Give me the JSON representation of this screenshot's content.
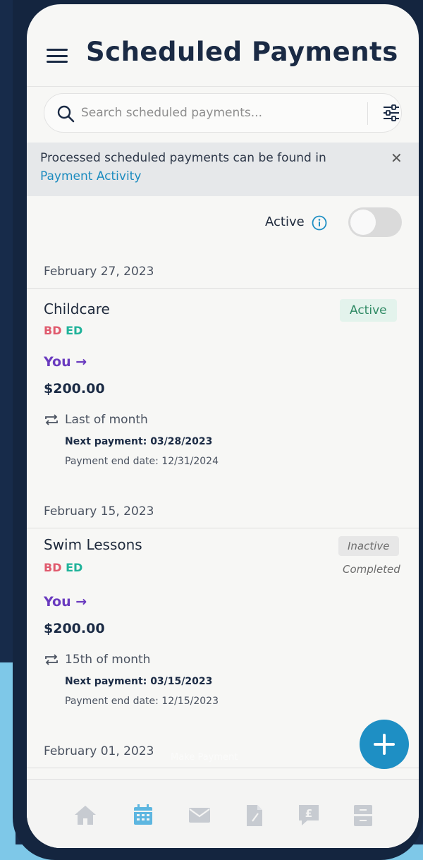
{
  "header": {
    "title": "Scheduled Payments",
    "menu_icon": "hamburger-icon"
  },
  "search": {
    "placeholder": "Search scheduled payments...",
    "value": ""
  },
  "banner": {
    "text": "Processed scheduled payments can be found in",
    "link": "Payment Activity",
    "close": "✕"
  },
  "filter": {
    "label": "Active",
    "toggle_on": false
  },
  "groups": [
    {
      "date": "February 27, 2023",
      "payment": {
        "title": "Childcare",
        "initials": [
          "BD",
          "ED"
        ],
        "payer": "You →",
        "amount": "$200.00",
        "frequency": "Last of month",
        "next": "Next payment: 03/28/2023",
        "end": "Payment end date: 12/31/2024",
        "status": "Active"
      }
    },
    {
      "date": "February 15, 2023",
      "payment": {
        "title": "Swim Lessons",
        "initials": [
          "BD",
          "ED"
        ],
        "payer": "You →",
        "amount": "$200.00",
        "frequency": "15th of month",
        "next": "Next payment: 03/15/2023",
        "end": "Payment end date: 12/15/2023",
        "status": "Inactive",
        "status_note": "Completed"
      }
    },
    {
      "date": "February 01, 2023"
    }
  ],
  "fab": {
    "icon": "plus-icon",
    "tooltip": "Make Payment"
  },
  "nav": {
    "items": [
      "home-icon",
      "calendar-icon",
      "mail-icon",
      "document-icon",
      "pound-icon",
      "drawer-icon"
    ],
    "active_index": 1
  },
  "colors": {
    "accent": "#1e8fc4",
    "payer": "#6a3bbf",
    "bd": "#e05a6d",
    "ed": "#20b39a",
    "active_badge_bg": "#e3f3ec",
    "active_badge_text": "#2f8a64",
    "nav_icon": "#c7cbd1",
    "nav_active": "#5db6e0"
  }
}
